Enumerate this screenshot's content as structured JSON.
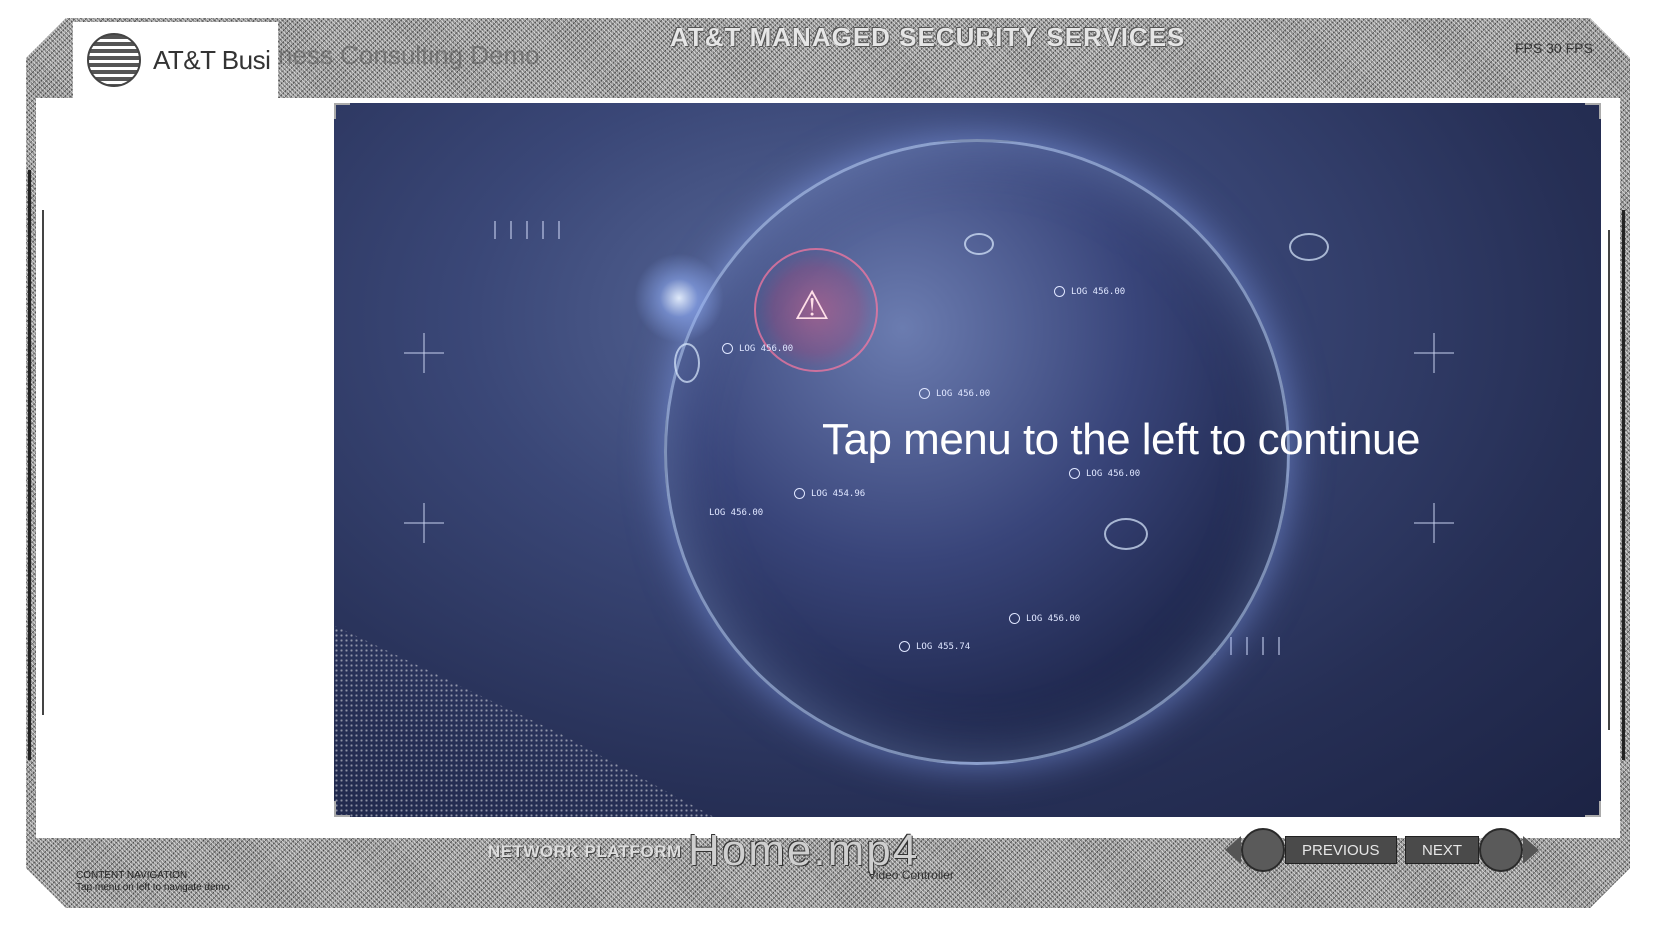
{
  "header": {
    "brand": "AT&T Busi",
    "brand_overflow": "ness Consulting Demo",
    "title": "AT&T MANAGED SECURITY SERVICES",
    "right_text": "FPS 30 FPS"
  },
  "video": {
    "overlay_text": "Tap menu to the left to continue",
    "logs": [
      "LOG 456.00",
      "LOG 456.00",
      "LOG 456.00",
      "LOG 454.96",
      "LOG 456.00",
      "LOG 456.00",
      "LOG 455.74",
      "LOG 456.00"
    ]
  },
  "footer": {
    "section_label": "NETWORK PLATFORM",
    "file_name": "Home.mp4",
    "file_sub": "Video Controller",
    "content_nav_line1": "CONTENT NAVIGATION",
    "content_nav_line2": "Tap menu on left to navigate demo",
    "previous_label": "PREVIOUS",
    "next_label": "NEXT"
  }
}
